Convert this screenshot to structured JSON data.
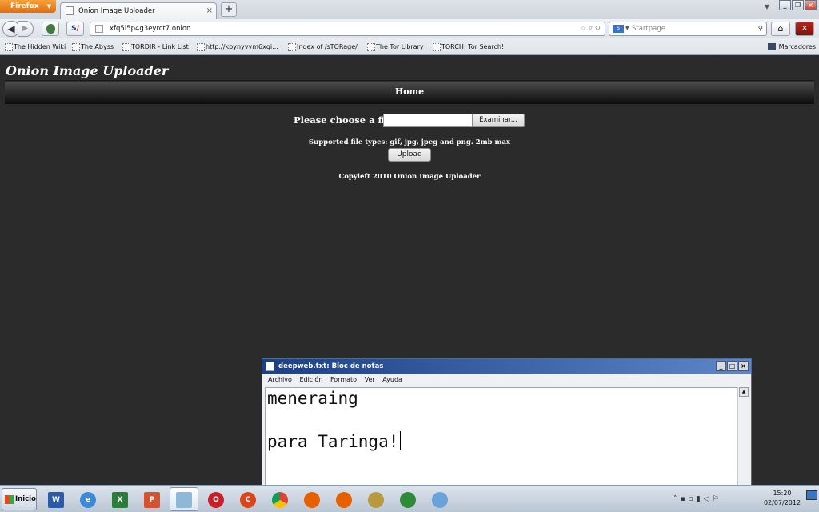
{
  "browser": {
    "menu_button": "Firefox",
    "tab_title": "Onion Image Uploader",
    "url": "xfq5l5p4g3eyrct7.onion",
    "search_placeholder": "Startpage",
    "bookmarks": [
      "The Hidden Wiki",
      "The Abyss",
      "TORDIR - Link List",
      "http://kpynyvym6xqi...",
      "Index of /sTORage/",
      "The Tor Library",
      "TORCH: Tor Search!"
    ],
    "bookmarks_menu": "Marcadores"
  },
  "page": {
    "site_title": "Onion Image Uploader",
    "nav_home": "Home",
    "choose_label": "Please choose a file:",
    "browse_button": "Examinar...",
    "supported_text": "Supported file types: gif, jpg, jpeg and png. 2mb max",
    "upload_button": "Upload",
    "copyleft": "Copyleft 2010 Onion Image Uploader"
  },
  "notepad": {
    "title": "deepweb.txt: Bloc de notas",
    "menu": [
      "Archivo",
      "Edición",
      "Formato",
      "Ver",
      "Ayuda"
    ],
    "line1": "meneraing",
    "line2": "",
    "line3": "para Taringa!"
  },
  "taskbar": {
    "start_label": "Inicio",
    "time": "15:20",
    "date": "02/07/2012",
    "apps": [
      "word-icon",
      "internet-explorer-icon",
      "excel-icon",
      "presentation-icon",
      "notepad-icon",
      "opera-icon",
      "ccleaner-icon",
      "chrome-icon",
      "firefox-icon",
      "firefox-icon",
      "tor-onion-icon",
      "vuze-icon",
      "paint-icon"
    ]
  },
  "colors": {
    "page_background": "#2b2b2b",
    "firefox_orange": "#e67e22",
    "notepad_titlebar": "#1c3f86"
  }
}
